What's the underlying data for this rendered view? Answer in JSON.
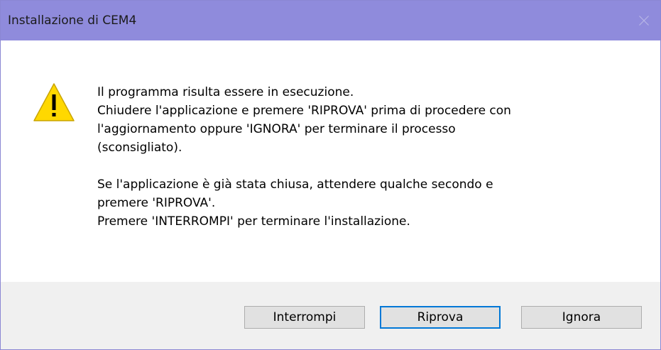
{
  "window": {
    "title": "Installazione di CEM4",
    "close_icon": "close-icon"
  },
  "message": {
    "icon": "warning-icon",
    "lines_1": [
      "Il programma risulta essere in esecuzione.",
      "Chiudere l'applicazione e premere 'RIPROVA' prima di procedere con",
      "l'aggiornamento oppure 'IGNORA' per terminare il processo",
      "(sconsigliato)."
    ],
    "lines_2": [
      "Se l'applicazione è già stata chiusa, attendere qualche secondo e",
      "premere 'RIPROVA'.",
      "Premere 'INTERROMPI' per terminare l'installazione."
    ]
  },
  "buttons": {
    "abort": "Interrompi",
    "retry": "Riprova",
    "ignore": "Ignora"
  },
  "colors": {
    "titlebar": "#8f8bdc",
    "default_button_border": "#0078d7",
    "warning_fill": "#ffd800"
  }
}
